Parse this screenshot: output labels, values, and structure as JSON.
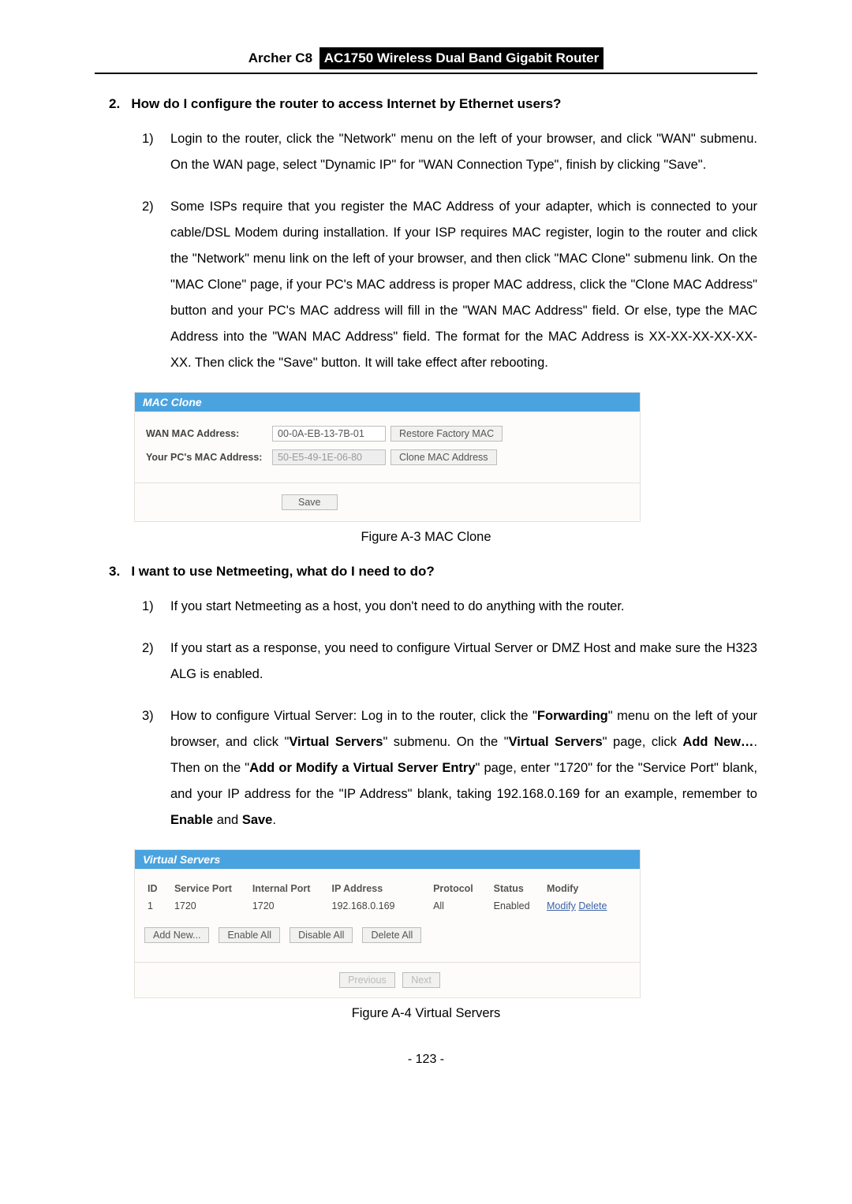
{
  "header": {
    "model": "Archer C8",
    "product": "AC1750 Wireless Dual Band Gigabit Router"
  },
  "q2": {
    "number": "2.",
    "title": "How do I configure the router to access Internet by Ethernet users?",
    "steps": [
      {
        "n": "1)",
        "t": "Login to the router, click the \"Network\" menu on the left of your browser, and click \"WAN\" submenu. On the WAN page, select \"Dynamic IP\" for \"WAN Connection Type\", finish by clicking \"Save\"."
      },
      {
        "n": "2)",
        "t": "Some ISPs require that you register the MAC Address of your adapter, which is connected to your cable/DSL Modem during installation. If your ISP requires MAC register, login to the router and click the \"Network\" menu link on the left of your browser, and then click \"MAC Clone\" submenu link. On the \"MAC Clone\" page, if your PC's MAC address is proper MAC address, click the \"Clone MAC Address\" button and your PC's MAC address will fill in the \"WAN MAC Address\" field. Or else, type the MAC Address into the \"WAN MAC Address\" field. The format for the MAC Address is XX-XX-XX-XX-XX-XX. Then click the \"Save\" button. It will take effect after rebooting."
      }
    ]
  },
  "mac": {
    "panel_title": "MAC Clone",
    "wan_label": "WAN MAC Address:",
    "wan_value": "00-0A-EB-13-7B-01",
    "restore_btn": "Restore Factory MAC",
    "pc_label": "Your PC's MAC Address:",
    "pc_value": "50-E5-49-1E-06-80",
    "clone_btn": "Clone MAC Address",
    "save": "Save",
    "figcap": "Figure A-3 MAC Clone"
  },
  "q3": {
    "number": "3.",
    "title": "I want to use Netmeeting, what do I need to do?",
    "step1_n": "1)",
    "step1_t": "If you start Netmeeting as a host, you don't need to do anything with the router.",
    "step2_n": "2)",
    "step2_t": "If you start as a response, you need to configure Virtual Server or DMZ Host and make sure the H323 ALG is enabled.",
    "step3_n": "3)",
    "step3_pre": "How to configure Virtual Server: Log in to the router, click the \"",
    "step3_b1": "Forwarding",
    "step3_m1": "\" menu on the left of your browser, and click \"",
    "step3_b2": "Virtual Servers",
    "step3_m2": "\" submenu. On the \"",
    "step3_b3": "Virtual Servers",
    "step3_m3": "\" page, click ",
    "step3_b4": "Add New…",
    "step3_m4": ". Then on the \"",
    "step3_b5": "Add or Modify a Virtual Server Entry",
    "step3_m5": "\" page, enter \"1720\" for the \"Service Port\" blank, and your IP address for the \"IP Address\" blank, taking 192.168.0.169 for an example, remember to ",
    "step3_b6": "Enable",
    "step3_m6": " and ",
    "step3_b7": "Save",
    "step3_end": "."
  },
  "vs": {
    "panel_title": "Virtual Servers",
    "headers": {
      "id": "ID",
      "sp": "Service Port",
      "ip": "Internal Port",
      "ipa": "IP Address",
      "pr": "Protocol",
      "st": "Status",
      "mod": "Modify"
    },
    "row": {
      "id": "1",
      "sp": "1720",
      "ip": "1720",
      "ipa": "192.168.0.169",
      "pr": "All",
      "st": "Enabled",
      "modify": "Modify",
      "delete": "Delete"
    },
    "add": "Add New...",
    "enable": "Enable All",
    "disable": "Disable All",
    "delete_all": "Delete All",
    "prev": "Previous",
    "next": "Next",
    "figcap": "Figure A-4 Virtual Servers"
  },
  "pagenum": "- 123 -"
}
